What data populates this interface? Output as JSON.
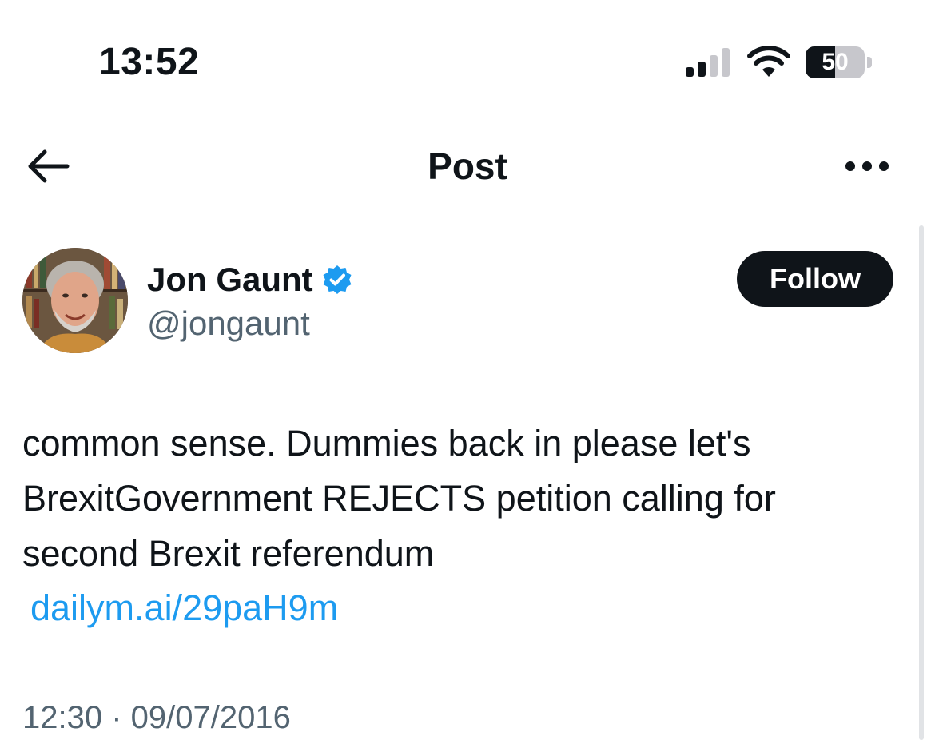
{
  "status_bar": {
    "time": "13:52",
    "battery_level": "50",
    "battery_fraction": 0.5
  },
  "nav": {
    "title": "Post",
    "back_icon": "arrow-left-icon",
    "more_icon": "more-horizontal-icon"
  },
  "author": {
    "name": "Jon Gaunt",
    "handle": "@jongaunt",
    "verified": true,
    "verified_icon": "verified-badge-icon",
    "follow_label": "Follow"
  },
  "tweet": {
    "lines": [
      "common sense. Dummies back in please let's",
      "BrexitGovernment REJECTS petition calling for",
      "second Brexit referendum"
    ],
    "link": "dailym.ai/29paH9m",
    "timestamp": "12:30 · 09/07/2016"
  },
  "colors": {
    "text": "#0f1419",
    "secondary": "#536471",
    "link": "#1d9bf0",
    "verified": "#1d9bf0",
    "button_bg": "#0f1419"
  }
}
